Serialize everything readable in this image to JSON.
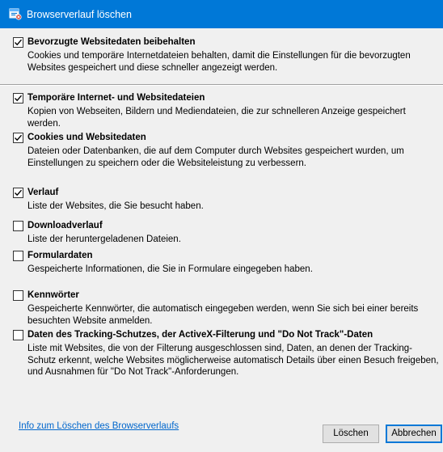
{
  "window": {
    "title": "Browserverlauf löschen"
  },
  "options": [
    {
      "label": "Bevorzugte Websitedaten beibehalten",
      "description": "Cookies und temporäre Internetdateien behalten, damit die Einstellungen für die bevorzugten Websites gespeichert und diese schneller angezeigt werden.",
      "checked": true
    },
    {
      "label": "Temporäre Internet- und Websitedateien",
      "description": "Kopien von Webseiten, Bildern und Mediendateien, die zur schnelleren Anzeige gespeichert werden.",
      "checked": true
    },
    {
      "label": "Cookies und Websitedaten",
      "description": "Dateien oder Datenbanken, die auf dem Computer durch Websites gespeichert wurden, um Einstellungen zu speichern oder die Websiteleistung zu verbessern.",
      "checked": true
    },
    {
      "label": "Verlauf",
      "description": "Liste der Websites, die Sie besucht haben.",
      "checked": true
    },
    {
      "label": "Downloadverlauf",
      "description": "Liste der heruntergeladenen Dateien.",
      "checked": false
    },
    {
      "label": "Formulardaten",
      "description": "Gespeicherte Informationen, die Sie in Formulare eingegeben haben.",
      "checked": false
    },
    {
      "label": "Kennwörter",
      "description": "Gespeicherte Kennwörter, die automatisch eingegeben werden, wenn Sie sich bei einer bereits besuchten Website anmelden.",
      "checked": false
    },
    {
      "label": "Daten des Tracking-Schutzes, der ActiveX-Filterung und \"Do Not Track\"-Daten",
      "description": "Liste mit Websites, die von der Filterung ausgeschlossen sind, Daten, an denen der Tracking-Schutz erkennt, welche Websites möglicherweise automatisch Details über einen Besuch freigeben, und Ausnahmen für \"Do Not Track\"-Anforderungen.",
      "checked": false
    }
  ],
  "footer": {
    "info_link": "Info zum Löschen des Browserverlaufs",
    "delete_button": "Löschen",
    "cancel_button": "Abbrechen"
  }
}
